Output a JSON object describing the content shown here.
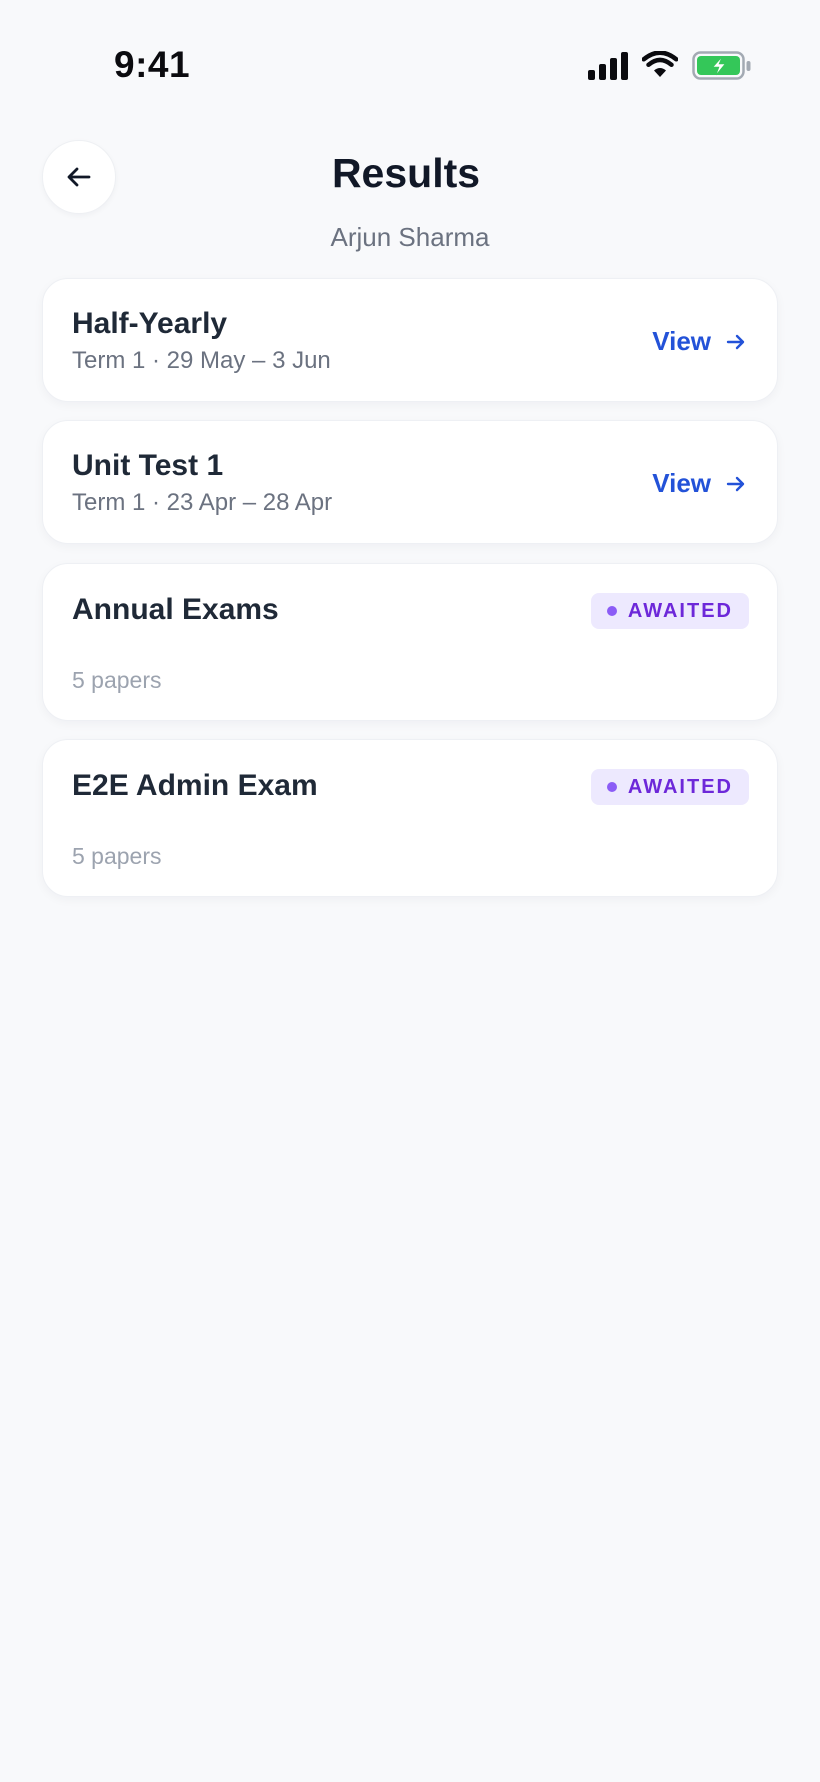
{
  "status_bar": {
    "time": "9:41",
    "icons": [
      "cellular-signal-icon",
      "wifi-icon",
      "battery-charging-icon"
    ]
  },
  "header": {
    "title": "Results",
    "subtitle": "Arjun Sharma",
    "back_icon": "arrow-left-icon"
  },
  "exams": [
    {
      "title": "Half-Yearly",
      "subtitle": "Term 1 · 29 May – 3 Jun",
      "action_label": "View"
    },
    {
      "title": "Unit Test 1",
      "subtitle": "Term 1 · 23 Apr – 28 Apr",
      "action_label": "View"
    },
    {
      "title": "Annual Exams",
      "status": "AWAITED",
      "meta": "5 papers"
    },
    {
      "title": "E2E Admin Exam",
      "status": "AWAITED",
      "meta": "5 papers"
    }
  ],
  "colors": {
    "background": "#f8f9fb",
    "link": "#2352d8",
    "badge_bg": "#ede9fe",
    "badge_text": "#6d28d9",
    "battery_green": "#34c759"
  }
}
